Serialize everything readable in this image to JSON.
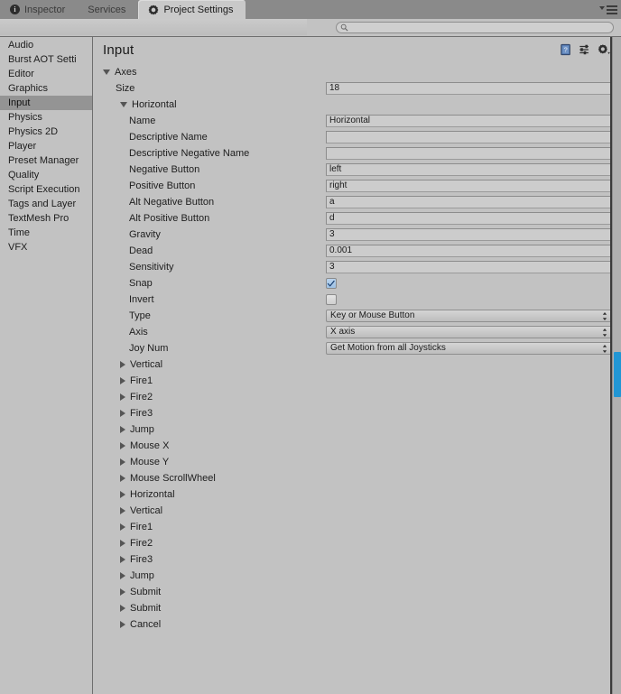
{
  "window": {
    "tabs": [
      {
        "label": "Inspector",
        "icon": "info-icon",
        "active": false
      },
      {
        "label": "Services",
        "icon": "none",
        "active": false
      },
      {
        "label": "Project Settings",
        "icon": "gear-icon",
        "active": true
      }
    ],
    "menu_button": "window-menu"
  },
  "search": {
    "value": "",
    "placeholder": ""
  },
  "sidebar": {
    "items": [
      {
        "label": "Audio",
        "selected": false
      },
      {
        "label": "Burst AOT Setti",
        "selected": false
      },
      {
        "label": "Editor",
        "selected": false
      },
      {
        "label": "Graphics",
        "selected": false
      },
      {
        "label": "Input",
        "selected": true
      },
      {
        "label": "Physics",
        "selected": false
      },
      {
        "label": "Physics 2D",
        "selected": false
      },
      {
        "label": "Player",
        "selected": false
      },
      {
        "label": "Preset Manager",
        "selected": false
      },
      {
        "label": "Quality",
        "selected": false
      },
      {
        "label": "Script Execution",
        "selected": false
      },
      {
        "label": "Tags and Layer",
        "selected": false
      },
      {
        "label": "TextMesh Pro",
        "selected": false
      },
      {
        "label": "Time",
        "selected": false
      },
      {
        "label": "VFX",
        "selected": false
      }
    ]
  },
  "main": {
    "title": "Input",
    "header_icons": [
      {
        "name": "help-icon"
      },
      {
        "name": "preset-icon"
      },
      {
        "name": "settings-gear-icon"
      }
    ],
    "axes_foldout": "Axes",
    "size_label": "Size",
    "size_value": "18",
    "expanded_axis": {
      "name": "Horizontal",
      "properties": [
        {
          "label": "Name",
          "value": "Horizontal",
          "kind": "text"
        },
        {
          "label": "Descriptive Name",
          "value": "",
          "kind": "text"
        },
        {
          "label": "Descriptive Negative Name",
          "value": "",
          "kind": "text"
        },
        {
          "label": "Negative Button",
          "value": "left",
          "kind": "text"
        },
        {
          "label": "Positive Button",
          "value": "right",
          "kind": "text"
        },
        {
          "label": "Alt Negative Button",
          "value": "a",
          "kind": "text"
        },
        {
          "label": "Alt Positive Button",
          "value": "d",
          "kind": "text"
        },
        {
          "label": "Gravity",
          "value": "3",
          "kind": "text"
        },
        {
          "label": "Dead",
          "value": "0.001",
          "kind": "text"
        },
        {
          "label": "Sensitivity",
          "value": "3",
          "kind": "text"
        },
        {
          "label": "Snap",
          "value": "true",
          "kind": "checkbox"
        },
        {
          "label": "Invert",
          "value": "false",
          "kind": "checkbox"
        },
        {
          "label": "Type",
          "value": "Key or Mouse Button",
          "kind": "popup"
        },
        {
          "label": "Axis",
          "value": "X axis",
          "kind": "popup"
        },
        {
          "label": "Joy Num",
          "value": "Get Motion from all Joysticks",
          "kind": "popup"
        }
      ]
    },
    "collapsed_axes": [
      {
        "label": "Vertical"
      },
      {
        "label": "Fire1"
      },
      {
        "label": "Fire2"
      },
      {
        "label": "Fire3"
      },
      {
        "label": "Jump"
      },
      {
        "label": "Mouse X"
      },
      {
        "label": "Mouse Y"
      },
      {
        "label": "Mouse ScrollWheel"
      },
      {
        "label": "Horizontal"
      },
      {
        "label": "Vertical"
      },
      {
        "label": "Fire1"
      },
      {
        "label": "Fire2"
      },
      {
        "label": "Fire3"
      },
      {
        "label": "Jump"
      },
      {
        "label": "Submit"
      },
      {
        "label": "Submit"
      },
      {
        "label": "Cancel"
      }
    ]
  },
  "colors": {
    "background": "#c2c2c2",
    "tabbar": "#8a8a8a",
    "selection": "#949494",
    "scrollbar_thumb": "#2196d4",
    "checkbox_on": "#9fc2e4"
  }
}
